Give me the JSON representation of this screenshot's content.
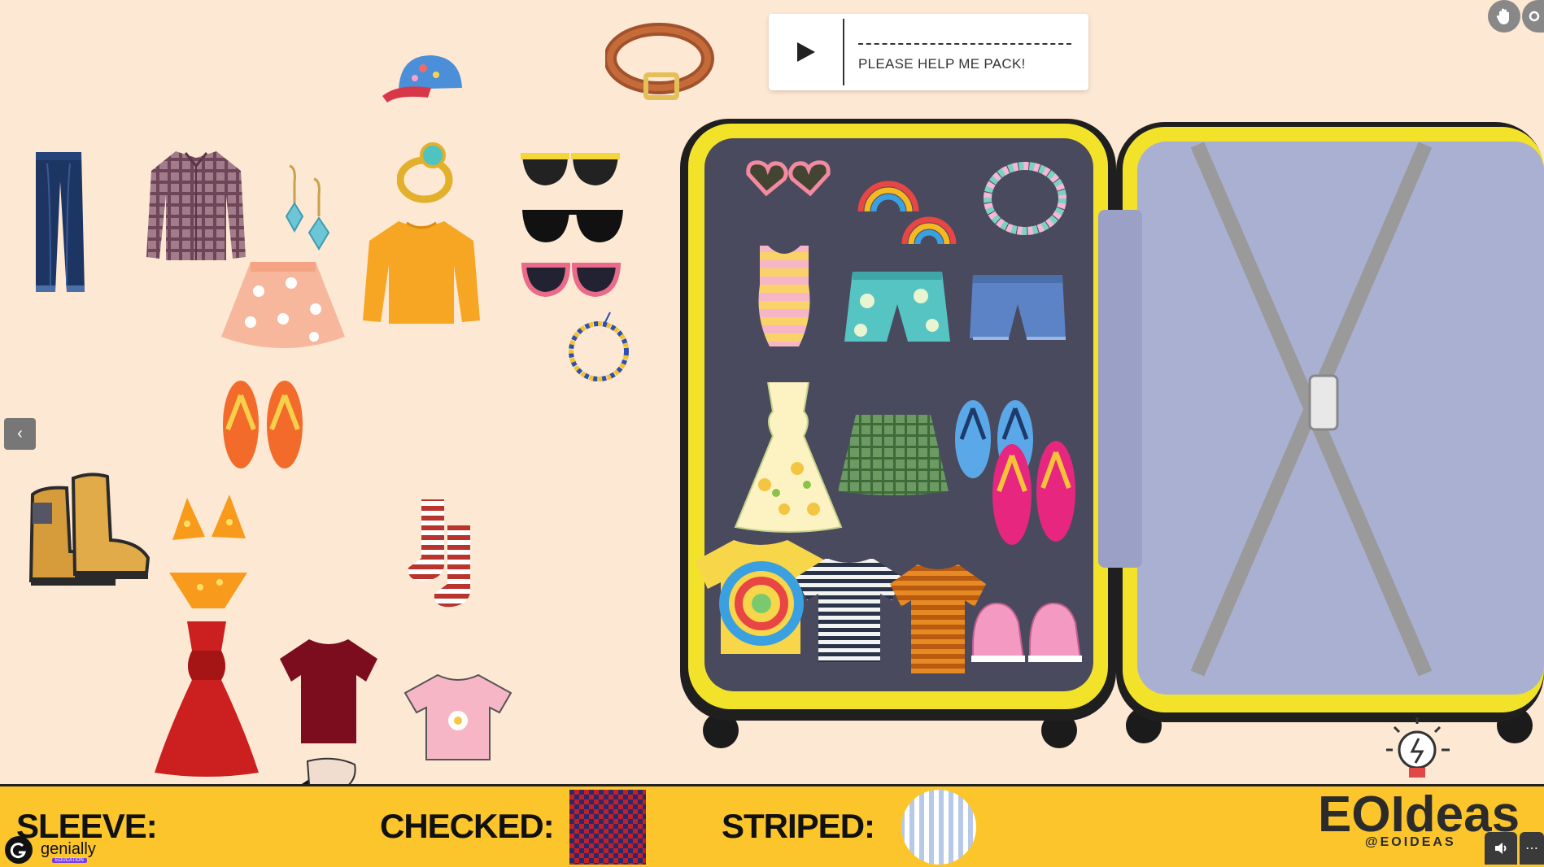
{
  "audio": {
    "title": "PLEASE HELP ME PACK!"
  },
  "nav": {
    "prev": "‹"
  },
  "bottom_bar": {
    "sleeve_label": "SLEEVE:",
    "checked_label": "CHECKED:",
    "striped_label": "STRIPED:"
  },
  "branding": {
    "main": "EOIdeas",
    "handle": "@EOIDEAS",
    "platform": "genially",
    "platform_tag": "EDUCATION"
  },
  "controls": {
    "volume": "🔊",
    "more": "⋯"
  },
  "colors": {
    "background": "#fde8d3",
    "bar": "#fcc52b",
    "suitcase_frame": "#f5e52a",
    "suitcase_lining": "#4b4a5e",
    "suitcase_inside": "#a9abcf"
  },
  "items": {
    "outside": [
      "jeans-icon",
      "plaid-shirt-icon",
      "earrings-icon",
      "cap-icon",
      "ring-icon",
      "belt-icon",
      "yellow-sunglasses-icon",
      "black-sunglasses-icon",
      "pink-sunglasses-icon",
      "bracelet-icon",
      "flower-skirt-icon",
      "yellow-sweater-icon",
      "orange-flipflops-icon",
      "boots-icon",
      "bikini-icon",
      "striped-socks-icon",
      "red-dress-icon",
      "maroon-tshirt-icon",
      "pink-tshirt-icon"
    ],
    "packed": [
      "heart-sunglasses-icon",
      "rainbow-earrings-icon",
      "smile-bracelet-icon",
      "swimsuit-icon",
      "floral-shorts-icon",
      "denim-shorts-icon",
      "sun-dress-icon",
      "green-skirt-icon",
      "blue-flipflops-icon",
      "pink-flipflops-icon",
      "tie-dye-shirt-icon",
      "striped-tshirt-icon",
      "orange-striped-tshirt-icon",
      "pink-sneakers-icon"
    ]
  }
}
